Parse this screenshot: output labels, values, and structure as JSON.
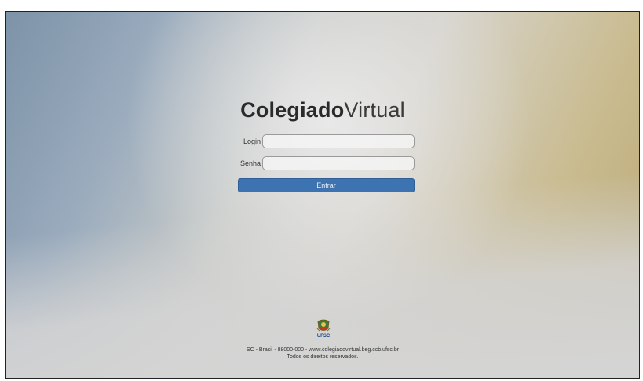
{
  "brand": {
    "bold": "Colegiado",
    "light": "Virtual"
  },
  "form": {
    "login_label": "Login",
    "login_value": "",
    "login_placeholder": "",
    "senha_label": "Senha",
    "senha_value": "",
    "senha_placeholder": "",
    "submit_label": "Entrar"
  },
  "logo": {
    "text": "UFSC",
    "icon": "ufsc-crest-icon"
  },
  "footer": {
    "line1": "SC - Brasil - 88000-000 - www.colegiadovirtual.beg.ccb.ufsc.br",
    "line2": "Todos os direitos reservados."
  },
  "colors": {
    "button": "#3d73b0",
    "bg_left": "#7d93a8",
    "bg_right": "#b8a673",
    "bg_bottom": "#d4d4d4"
  }
}
